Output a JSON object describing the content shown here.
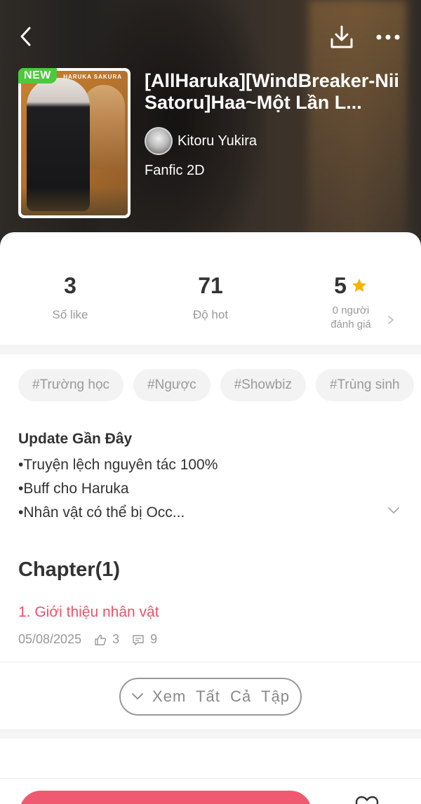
{
  "header": {
    "back_icon": "chevron-left-icon",
    "download_icon": "download-icon",
    "more_icon": "more-horizontal-icon"
  },
  "book": {
    "badge": "NEW",
    "cover_text": "HARUKA SAKURA",
    "title": "[AllHaruka][WindBreaker-NiiSatoru]Haa~Một Lần L...",
    "author": "Kitoru Yukira",
    "genre": "Fanfic 2D"
  },
  "stats": {
    "likes_value": "3",
    "likes_label": "Số like",
    "hot_value": "71",
    "hot_label": "Độ hot",
    "rating_value": "5",
    "rating_label_1": "0 người",
    "rating_label_2": "đánh giá",
    "star_color": "#f5b400"
  },
  "tags": [
    "#Trường học",
    "#Ngược",
    "#Showbiz",
    "#Trùng sinh"
  ],
  "update": {
    "title": "Update Gần Đây",
    "lines": [
      "•Truyện lệch nguyên tác 100%",
      "•Buff cho Haruka",
      "•Nhân vật có thể bị Occ..."
    ]
  },
  "chapters": {
    "heading": "Chapter(1)",
    "items": [
      {
        "name": "1. Giới thiệu nhân vật",
        "date": "05/08/2025",
        "likes": "3",
        "comments": "9"
      }
    ],
    "view_all_label": "Xem  Tất  Cả  Tập"
  },
  "colors": {
    "accent": "#e8546b",
    "read_button": "#f05a70",
    "badge_green": "#4cc93e"
  }
}
